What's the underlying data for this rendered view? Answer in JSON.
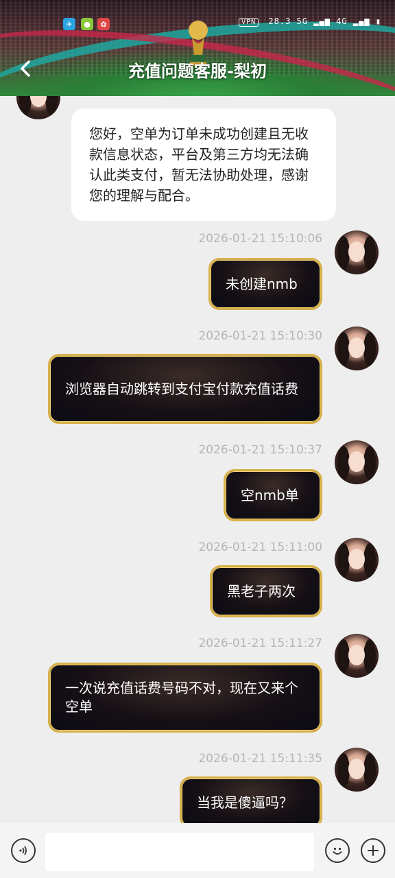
{
  "status_bar": {
    "time_info": "28.3",
    "network": "5G",
    "network2": "4G",
    "vpn": "VPN"
  },
  "header": {
    "title": "充值问题客服-梨初"
  },
  "messages": [
    {
      "from": "agent",
      "text": "您好，空单为订单未成功创建且无收款信息状态，平台及第三方均无法确认此类支付，暂无法协助处理，感谢您的理解与配合。"
    },
    {
      "from": "user",
      "timestamp": "2026-01-21 15:10:06",
      "text": "未创建nmb"
    },
    {
      "from": "user",
      "timestamp": "2026-01-21 15:10:30",
      "text": "浏览器自动跳转到支付宝付款充值话费"
    },
    {
      "from": "user",
      "timestamp": "2026-01-21 15:10:37",
      "text": "空nmb单"
    },
    {
      "from": "user",
      "timestamp": "2026-01-21 15:11:00",
      "text": "黑老子两次"
    },
    {
      "from": "user",
      "timestamp": "2026-01-21 15:11:27",
      "text": "一次说充值话费号码不对，现在又来个空单"
    },
    {
      "from": "user",
      "timestamp": "2026-01-21 15:11:35",
      "text": "当我是傻逼吗？"
    }
  ],
  "input": {
    "value": "",
    "placeholder": ""
  },
  "colors": {
    "bubble_border": "#d8b04a",
    "bubble_bg": "#0b0a14",
    "chat_bg": "#eeeeef"
  }
}
